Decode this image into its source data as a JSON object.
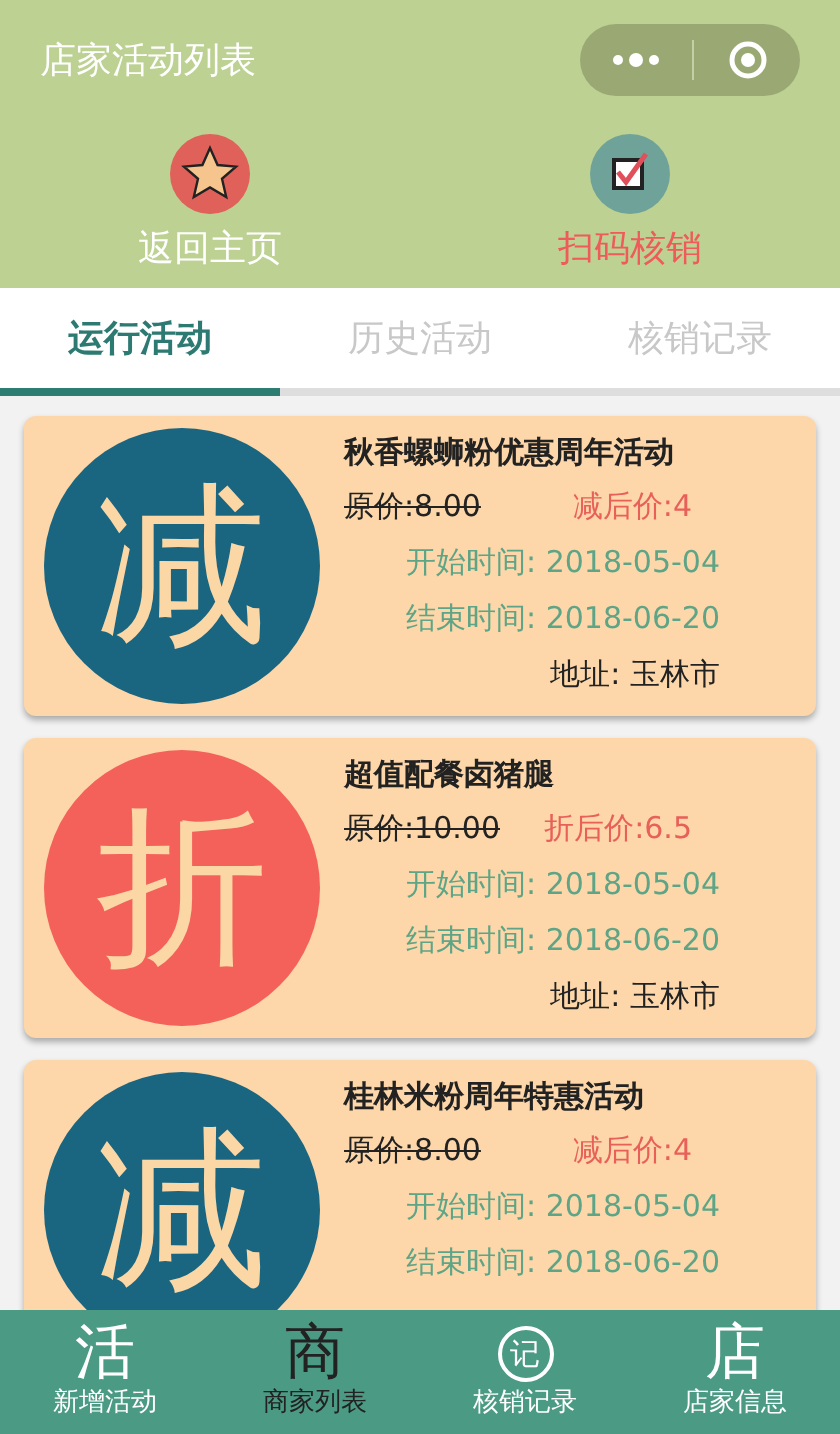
{
  "header": {
    "title": "店家活动列表"
  },
  "actions": [
    {
      "kind": "home",
      "label": "返回主页"
    },
    {
      "kind": "scan",
      "label": "扫码核销"
    }
  ],
  "tabs": [
    {
      "label": "运行活动",
      "selected": true
    },
    {
      "label": "历史活动",
      "selected": false
    },
    {
      "label": "核销记录",
      "selected": false
    }
  ],
  "activities": [
    {
      "badge": "减",
      "color": "#1a6580",
      "title": "秋香螺蛳粉优惠周年活动",
      "original_price": "原价:8.00",
      "discount_price": "减后价:4",
      "start": "开始时间: 2018-05-04",
      "end": "结束时间: 2018-06-20",
      "address": "地址: 玉林市"
    },
    {
      "badge": "折",
      "color": "#f4615a",
      "title": "超值配餐卤猪腿",
      "original_price": "原价:10.00",
      "discount_price": "折后价:6.5",
      "start": "开始时间: 2018-05-04",
      "end": "结束时间: 2018-06-20",
      "address": "地址: 玉林市"
    },
    {
      "badge": "减",
      "color": "#1a6580",
      "title": "桂林米粉周年特惠活动",
      "original_price": "原价:8.00",
      "discount_price": "减后价:4",
      "start": "开始时间: 2018-05-04",
      "end": "结束时间: 2018-06-20"
    }
  ],
  "bottom_nav": [
    {
      "icon": "活",
      "label": "新增活动",
      "kind": "plain",
      "selected": false
    },
    {
      "icon": "商",
      "label": "商家列表",
      "kind": "plain",
      "selected": true
    },
    {
      "icon": "记",
      "label": "核销记录",
      "kind": "circled",
      "selected": false
    },
    {
      "icon": "店",
      "label": "店家信息",
      "kind": "plain",
      "selected": false
    }
  ]
}
